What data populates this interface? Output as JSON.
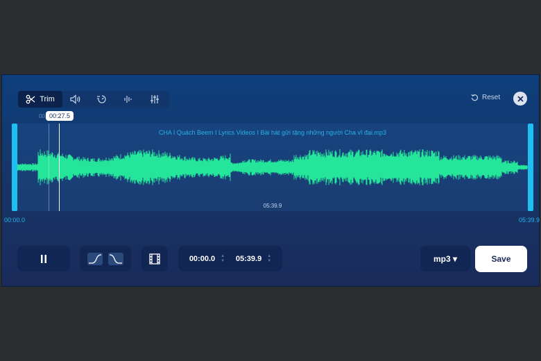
{
  "toolbar": {
    "trim_label": "Trim",
    "items": [
      {
        "icon": "scissors-icon"
      },
      {
        "icon": "volume-icon"
      },
      {
        "icon": "speed-icon"
      },
      {
        "icon": "equalizer-wave-icon"
      },
      {
        "icon": "mixer-sliders-icon"
      }
    ],
    "reset_label": "Reset"
  },
  "waveform": {
    "file_name": "CHA I Quách Beem I Lyrics Videos I Bài hát gửi tặng những người Cha vĩ đại.mp3",
    "playhead_time": "00:27.5",
    "ghost_time": "00:2",
    "duration_center": "05:39.9",
    "start_time": "00:00.0",
    "end_time": "05:39.9",
    "playhead_fraction": 0.081,
    "wave_color": "#25e59a"
  },
  "controls": {
    "start_value": "00:00.0",
    "end_value": "05:39.9",
    "format_label": "mp3 ▾",
    "save_label": "Save"
  },
  "colors": {
    "accent": "#1ec0f2",
    "wave": "#25e59a"
  }
}
